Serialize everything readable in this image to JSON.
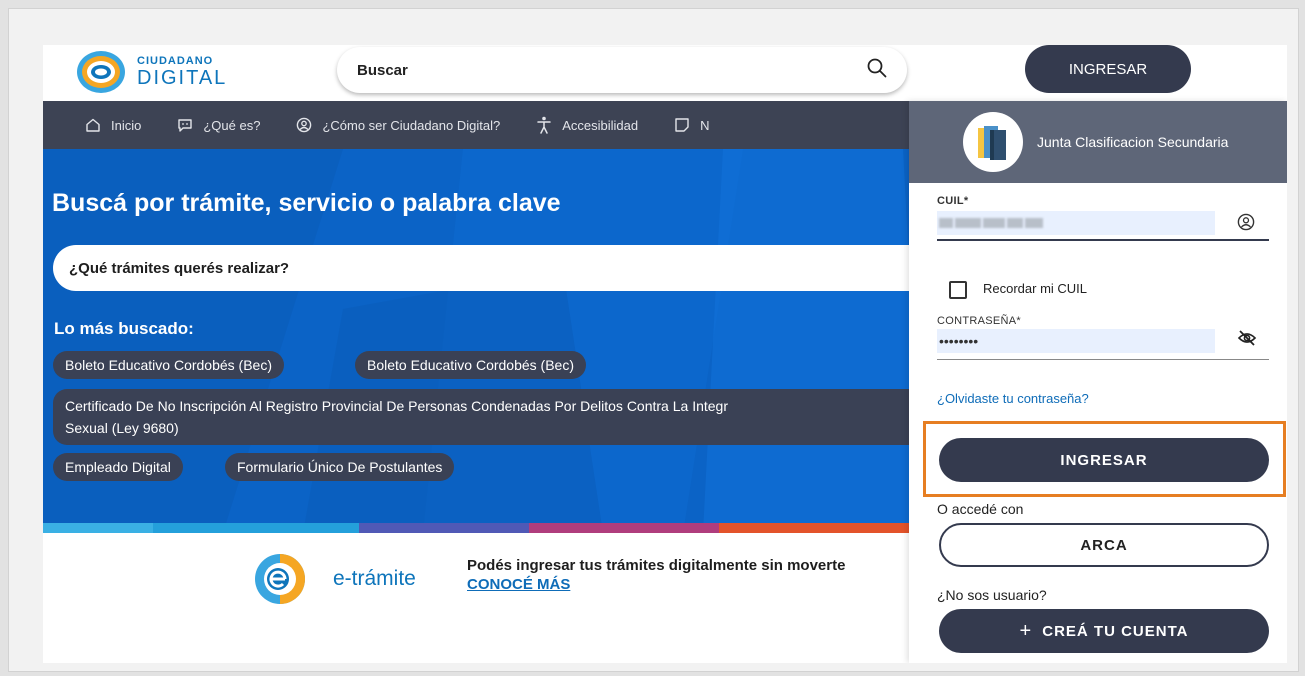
{
  "header": {
    "logo_line1": "CIUDADANO",
    "logo_line2": "DIGITAL",
    "search_label": "Buscar",
    "login_button": "INGRESAR"
  },
  "nav": {
    "items": [
      {
        "label": "Inicio",
        "icon": "home-icon"
      },
      {
        "label": "¿Qué es?",
        "icon": "chat-icon"
      },
      {
        "label": "¿Cómo ser Ciudadano Digital?",
        "icon": "user-circle-icon"
      },
      {
        "label": "Accesibilidad",
        "icon": "accessibility-icon"
      },
      {
        "label": "N",
        "icon": "note-icon"
      }
    ]
  },
  "hero": {
    "title": "Buscá por trámite, servicio o palabra clave",
    "search_placeholder": "¿Qué trámites querés realizar?",
    "most_searched_title": "Lo más buscado:",
    "chips": [
      "Boleto Educativo Cordobés (Bec)",
      "Boleto Educativo Cordobés (Bec)",
      "Certificado De No Inscripción Al Registro Provincial De Personas Condenadas Por Delitos Contra La Integr",
      "Sexual (Ley 9680)",
      "Empleado Digital",
      "Formulario Único De Postulantes"
    ]
  },
  "etramite": {
    "name": "e-trámite",
    "text": "Podés ingresar tus trámites digitalmente sin moverte",
    "link": "CONOCÉ MÁS"
  },
  "login_panel": {
    "organization": "Junta Clasificacion Secundaria",
    "cuil_label": "CUIL*",
    "remember_label": "Recordar mi CUIL",
    "password_label": "CONTRASEÑA*",
    "password_value": "••••••••",
    "forgot_link": "¿Olvidaste tu contraseña?",
    "login_button": "INGRESAR",
    "alt_access_text": "O accedé con",
    "arca_button": "ARCA",
    "no_user_text": "¿No sos usuario?",
    "create_account_button": "CREÁ TU CUENTA",
    "highlight_color": "#e67e22"
  },
  "colors": {
    "primary_dark": "#343a4e",
    "nav_bg": "#3d4354",
    "hero_blue": "#0b63c6",
    "brand_blue": "#0e75bb"
  }
}
